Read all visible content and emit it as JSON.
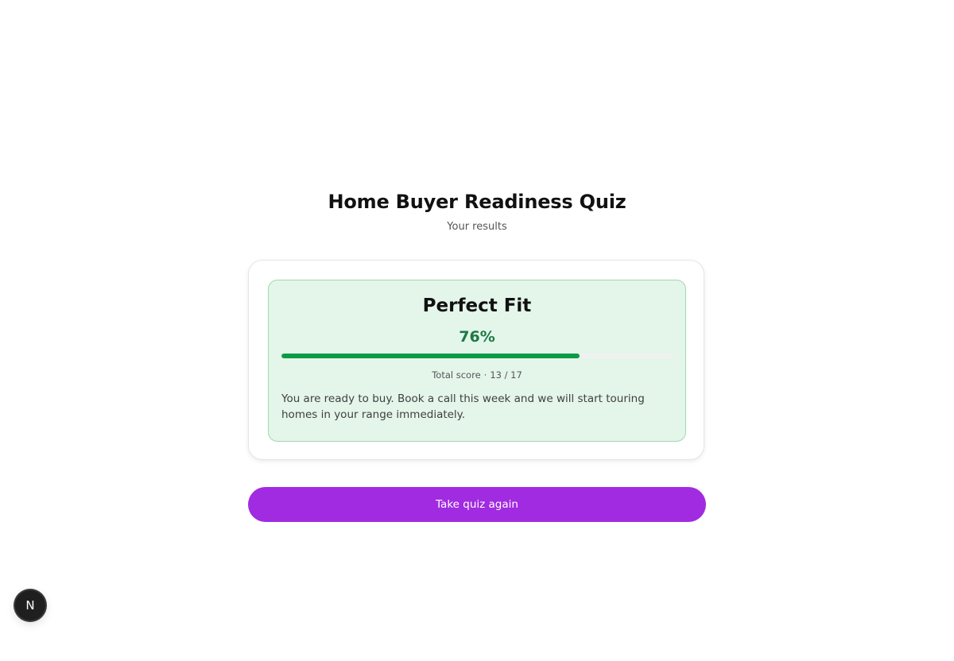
{
  "header": {
    "title": "Home Buyer Readiness Quiz",
    "subtitle": "Your results"
  },
  "result": {
    "title": "Perfect Fit",
    "percent_label": "76%",
    "progress_fraction": 0.76,
    "score_label": "Total score",
    "score_separator": "·",
    "score_value": "13 / 17",
    "message": "You are ready to buy. Book a call this week and we will start touring homes in your range immediately."
  },
  "actions": {
    "retake_label": "Take quiz again"
  },
  "dev_badge": {
    "letter": "N",
    "icon": "nextjs-icon"
  },
  "colors": {
    "accent": "#a12be0",
    "success": "#1b7a43",
    "progress": "#0b9b45",
    "result_bg": "#e4f5ea"
  }
}
